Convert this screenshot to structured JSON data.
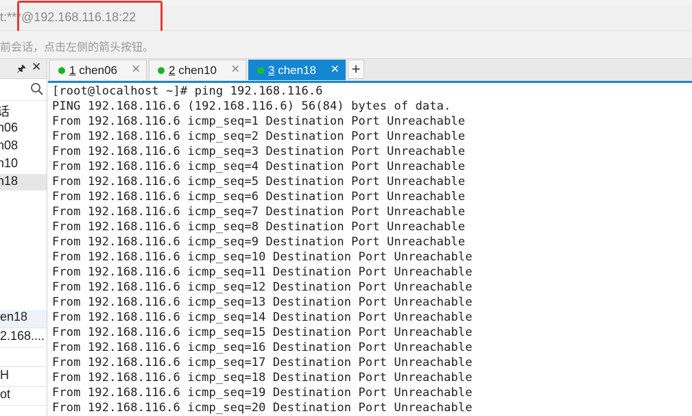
{
  "address_bar": {
    "text": "t:***@192.168.116.18:22"
  },
  "hint_bar": {
    "text": "前会话，点击左侧的箭头按钮。"
  },
  "left_panel": {
    "tree_items": [
      "话",
      "n06",
      "n08",
      "n10",
      "n18"
    ],
    "properties": [
      "en18",
      "2.168....",
      "",
      "H",
      "ot"
    ]
  },
  "tabs": [
    {
      "num": "1",
      "name": "chen06",
      "active": false
    },
    {
      "num": "2",
      "name": "chen10",
      "active": false
    },
    {
      "num": "3",
      "name": "chen18",
      "active": true
    }
  ],
  "newtab_label": "+",
  "colors": {
    "accent": "#1487d3",
    "status_dot": "#19b21a",
    "highlight_box": "#e53935"
  },
  "terminal": {
    "lines": [
      "[root@localhost ~]# ping 192.168.116.6",
      "PING 192.168.116.6 (192.168.116.6) 56(84) bytes of data.",
      "From 192.168.116.6 icmp_seq=1 Destination Port Unreachable",
      "From 192.168.116.6 icmp_seq=2 Destination Port Unreachable",
      "From 192.168.116.6 icmp_seq=3 Destination Port Unreachable",
      "From 192.168.116.6 icmp_seq=4 Destination Port Unreachable",
      "From 192.168.116.6 icmp_seq=5 Destination Port Unreachable",
      "From 192.168.116.6 icmp_seq=6 Destination Port Unreachable",
      "From 192.168.116.6 icmp_seq=7 Destination Port Unreachable",
      "From 192.168.116.6 icmp_seq=8 Destination Port Unreachable",
      "From 192.168.116.6 icmp_seq=9 Destination Port Unreachable",
      "From 192.168.116.6 icmp_seq=10 Destination Port Unreachable",
      "From 192.168.116.6 icmp_seq=11 Destination Port Unreachable",
      "From 192.168.116.6 icmp_seq=12 Destination Port Unreachable",
      "From 192.168.116.6 icmp_seq=13 Destination Port Unreachable",
      "From 192.168.116.6 icmp_seq=14 Destination Port Unreachable",
      "From 192.168.116.6 icmp_seq=15 Destination Port Unreachable",
      "From 192.168.116.6 icmp_seq=16 Destination Port Unreachable",
      "From 192.168.116.6 icmp_seq=17 Destination Port Unreachable",
      "From 192.168.116.6 icmp_seq=18 Destination Port Unreachable",
      "From 192.168.116.6 icmp_seq=19 Destination Port Unreachable",
      "From 192.168.116.6 icmp_seq=20 Destination Port Unreachable"
    ]
  }
}
